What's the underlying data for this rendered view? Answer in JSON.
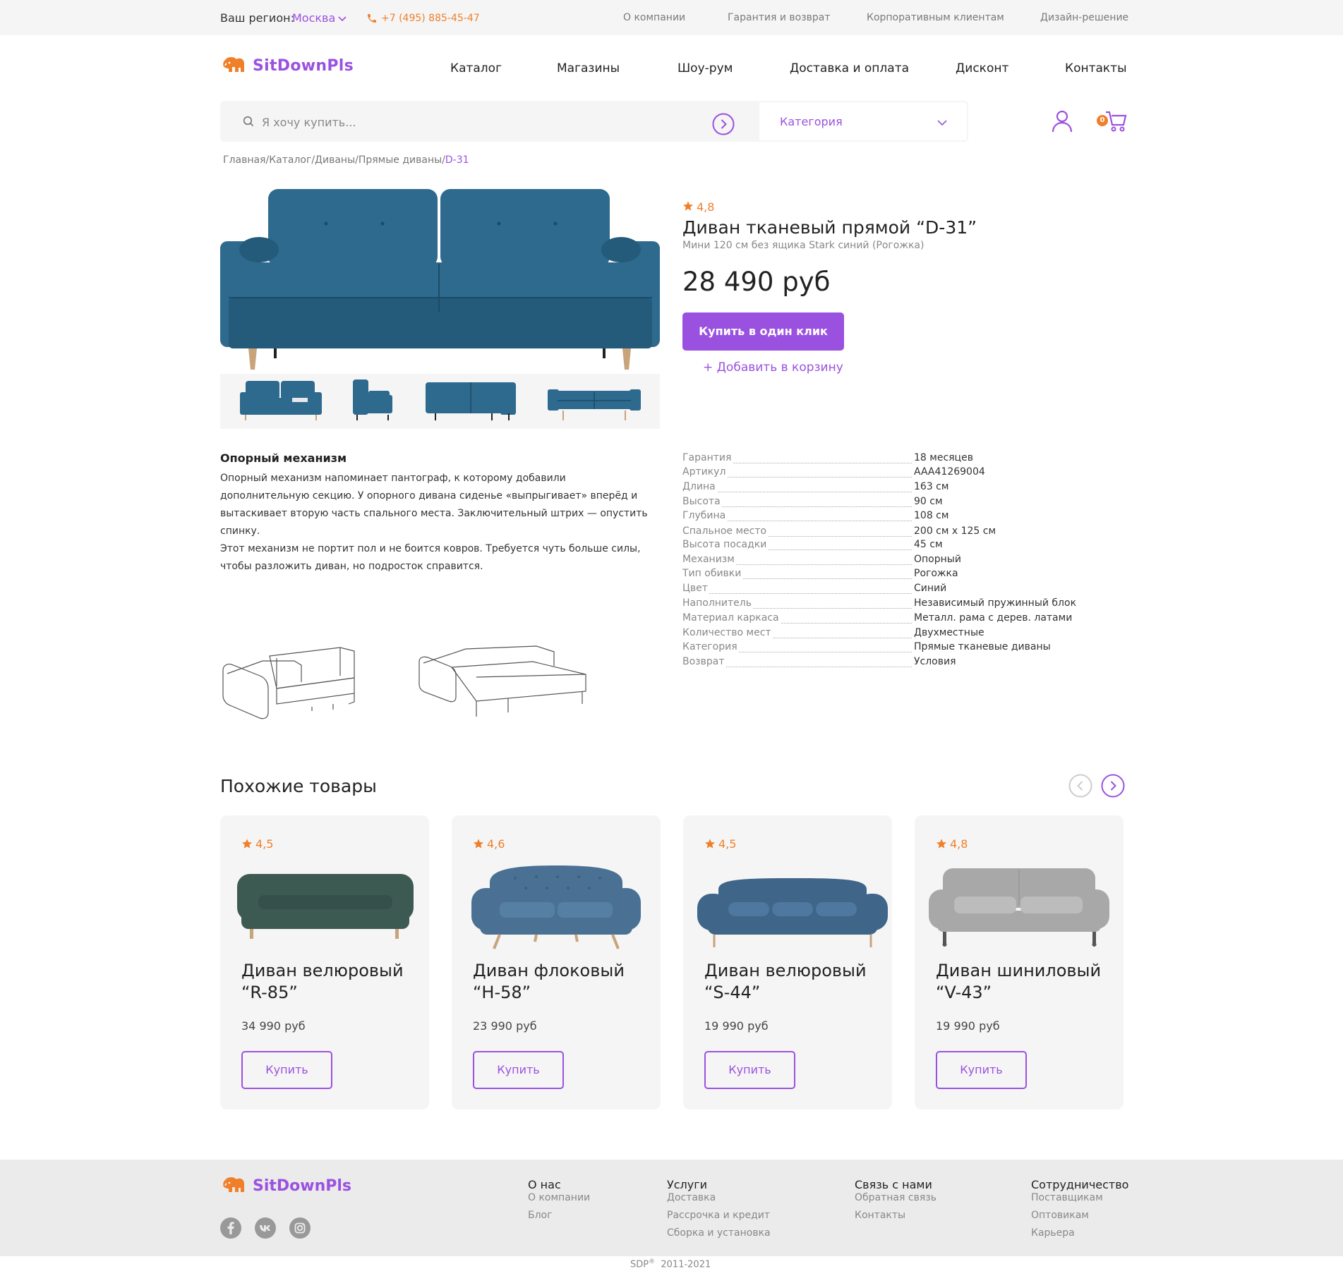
{
  "topbar": {
    "region_label": "Ваш регион:",
    "region_city": "Москва",
    "phone": "+7 (495) 885-45-47",
    "links": [
      "О компании",
      "Гарантия и возврат",
      "Корпоративным клиентам",
      "Дизайн-решение"
    ]
  },
  "header": {
    "logo": "SitDownPls",
    "nav": [
      "Каталог",
      "Магазины",
      "Шоу-рум",
      "Доставка и оплата",
      "Дисконт",
      "Контакты"
    ]
  },
  "search": {
    "placeholder": "Я хочу купить...",
    "category_label": "Категория",
    "cart_count": "0"
  },
  "breadcrumb": [
    "Главная",
    "Каталог",
    "Диваны",
    "Прямые диваны"
  ],
  "breadcrumb_current": "D-31",
  "product": {
    "rating": "4,8",
    "title": "Диван тканевый прямой “D-31”",
    "subtitle": "Мини 120 см без ящика Stark синий (Рогожка)",
    "price": "28 490 руб",
    "buy_one_click": "Купить в один клик",
    "add_to_cart": "+ Добавить в корзину",
    "color": "#2d6a8e"
  },
  "mechanism": {
    "title": "Опорный механизм",
    "text_1": "Опорный механизм напоминает пантограф, к которому добавили дополнительную секцию. У опорного дивана сиденье «выпрыгивает» вперёд и вытаскивает вторую часть спального места. Заключительный штрих — опустить спинку.",
    "text_2": "Этот механизм не портит пол и не боится ковров. Требуется чуть больше силы, чтобы разложить диван, но подросток справится."
  },
  "specs": [
    {
      "key": "Гарантия",
      "value": "18 месяцев"
    },
    {
      "key": "Артикул",
      "value": "AAA41269004"
    },
    {
      "key": "Длина",
      "value": "163 см"
    },
    {
      "key": "Высота",
      "value": "90 см"
    },
    {
      "key": "Глубина",
      "value": "108 см"
    },
    {
      "key": "Спальное место",
      "value": "200 см х 125 см"
    },
    {
      "key": "Высота посадки",
      "value": "45 см"
    },
    {
      "key": "Механизм",
      "value": "Опорный"
    },
    {
      "key": "Тип обивки",
      "value": "Рогожка"
    },
    {
      "key": "Цвет",
      "value": "Синий"
    },
    {
      "key": "Наполнитель",
      "value": "Независимый пружинный блок"
    },
    {
      "key": "Материал каркаса",
      "value": "Металл. рама с дерев. латами"
    },
    {
      "key": "Количество мест",
      "value": "Двухместные"
    },
    {
      "key": "Категория",
      "value": "Прямые тканевые диваны"
    },
    {
      "key": "Возврат",
      "value": "Условия"
    }
  ],
  "similar": {
    "title": "Похожие товары",
    "buy_label": "Купить",
    "items": [
      {
        "rating": "4,5",
        "title": "Диван велюровый “R-85”",
        "price": "34 990 руб",
        "color": "#3d5a52"
      },
      {
        "rating": "4,6",
        "title": "Диван флоковый “H-58”",
        "price": "23 990 руб",
        "color": "#4a7194"
      },
      {
        "rating": "4,5",
        "title": "Диван велюровый “S-44”",
        "price": "19 990 руб",
        "color": "#3f6588"
      },
      {
        "rating": "4,8",
        "title": "Диван шиниловый “V-43”",
        "price": "19 990 руб",
        "color": "#a8a8a8"
      }
    ]
  },
  "footer": {
    "logo": "SitDownPls",
    "columns": [
      {
        "title": "О нас",
        "links": [
          "О компании",
          "Блог"
        ]
      },
      {
        "title": "Услуги",
        "links": [
          "Доставка",
          "Рассрочка и кредит",
          "Сборка и установка"
        ]
      },
      {
        "title": "Связь с нами",
        "links": [
          "Обратная связь",
          "Контакты"
        ]
      },
      {
        "title": "Сотрудничество",
        "links": [
          "Поставщикам",
          "Оптовикам",
          "Карьера"
        ]
      }
    ],
    "socials": [
      "facebook-icon",
      "vk-icon",
      "instagram-icon"
    ],
    "copyright_brand": "SDP",
    "copyright_mark": "®",
    "copyright_years": "2011-2021"
  },
  "colors": {
    "accent": "#9b51e0",
    "orange": "#f07f2a"
  }
}
